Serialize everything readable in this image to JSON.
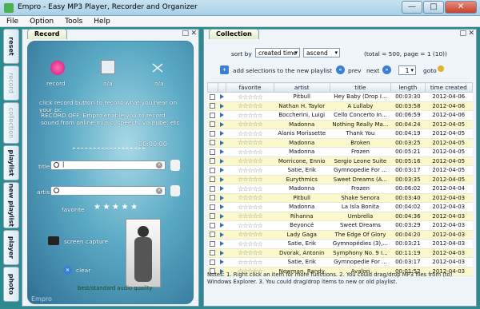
{
  "window": {
    "title": "Empro - Easy MP3 Player, Recorder and Organizer",
    "minimize": "—",
    "maximize": "□",
    "close": "✕"
  },
  "menu": [
    "File",
    "Option",
    "Tools",
    "Help"
  ],
  "sidetabs": [
    {
      "label": "reset",
      "dim": false
    },
    {
      "label": "record",
      "dim": true
    },
    {
      "label": "collection",
      "dim": true
    },
    {
      "label": "playlist",
      "dim": false
    },
    {
      "label": "new playlist",
      "dim": false
    },
    {
      "label": "player",
      "dim": false
    },
    {
      "label": "photo",
      "dim": false
    }
  ],
  "record": {
    "tab_label": "Record",
    "buttons": [
      {
        "label": "record",
        "icon": "record-dot-icon"
      },
      {
        "label": "n/a",
        "icon": "floppy-save-icon"
      },
      {
        "label": "n/a",
        "icon": "scissors-icon"
      }
    ],
    "hint": "click record button to record what you hear on your pc",
    "description": "RECORD.OFF: Empro enable you to record sound from online music, speech, youtube, etc.",
    "timer": "00:00:00",
    "title_label": "title",
    "title_value": "|",
    "artist_label": "artist",
    "artist_value": "",
    "favorite_label": "favorite",
    "favorite_stars": 5,
    "screen_capture_label": "screen capture",
    "clear_label": "clear",
    "quality_label": "best/standard audio quality",
    "ctrl_pin": "□",
    "ctrl_close": "✕"
  },
  "collection": {
    "tab_label": "Collection",
    "sort_label": "sort by",
    "sort_field": "created time",
    "sort_order": "ascend",
    "stats": "(total = 500, page = 1 (10))",
    "add_label": "add selections to the new playlist",
    "prev_label": "prev",
    "next_label": "next",
    "page_value": "1",
    "goto_label": "goto",
    "columns": [
      "favorite",
      "artist",
      "title",
      "length",
      "time created"
    ],
    "rows": [
      {
        "artist": "Pitbull",
        "title": "Hey Baby (Drop I...",
        "length": "00:03:30",
        "created": "2012-04-06"
      },
      {
        "artist": "Nathan H. Taylor",
        "title": "A Lullaby",
        "length": "00:03:58",
        "created": "2012-04-06"
      },
      {
        "artist": "Boccherini, Luigi",
        "title": "Cello Concerto In...",
        "length": "00:06:59",
        "created": "2012-04-06"
      },
      {
        "artist": "Madonna",
        "title": "Nothing Really Ma...",
        "length": "00:04:24",
        "created": "2012-04-05"
      },
      {
        "artist": "Alanis Morissette",
        "title": "Thank You",
        "length": "00:04:19",
        "created": "2012-04-05"
      },
      {
        "artist": "Madonna",
        "title": "Broken",
        "length": "00:03:25",
        "created": "2012-04-05"
      },
      {
        "artist": "Madonna",
        "title": "Frozen",
        "length": "00:05:21",
        "created": "2012-04-05"
      },
      {
        "artist": "Morricone, Ennio",
        "title": "Sergio Leone Suite",
        "length": "00:05:16",
        "created": "2012-04-05"
      },
      {
        "artist": "Satie, Erik",
        "title": "Gymnopedie For ...",
        "length": "00:03:17",
        "created": "2012-04-05"
      },
      {
        "artist": "Eurythmics",
        "title": "Sweet Dreams (A...",
        "length": "00:03:35",
        "created": "2012-04-05"
      },
      {
        "artist": "Madonna",
        "title": "Frozen",
        "length": "00:06:02",
        "created": "2012-04-04"
      },
      {
        "artist": "Pitbull",
        "title": "Shake Senora",
        "length": "00:03:40",
        "created": "2012-04-03"
      },
      {
        "artist": "Madonna",
        "title": "La Isla Bonita",
        "length": "00:04:02",
        "created": "2012-04-03"
      },
      {
        "artist": "Rihanna",
        "title": "Umbrella",
        "length": "00:04:36",
        "created": "2012-04-03"
      },
      {
        "artist": "Beyoncé",
        "title": "Sweet Dreams",
        "length": "00:03:29",
        "created": "2012-04-03"
      },
      {
        "artist": "Lady Gaga",
        "title": "The Edge Of Glory",
        "length": "00:04:20",
        "created": "2012-04-03"
      },
      {
        "artist": "Satie, Erik",
        "title": "Gymnopédies (3),...",
        "length": "00:03:21",
        "created": "2012-04-03"
      },
      {
        "artist": "Dvorak, Antonin",
        "title": "Symphony No. 9 I...",
        "length": "00:11:19",
        "created": "2012-04-03"
      },
      {
        "artist": "Satie, Erik",
        "title": "Gymnopedie For ...",
        "length": "00:03:17",
        "created": "2012-04-03"
      },
      {
        "artist": "Newman, Randy",
        "title": "Avalon",
        "length": "00:01:52",
        "created": "2012-04-03"
      }
    ],
    "notes": "Notes: 1. Right click an item for more functions. 2. You could drag/drop MP3 files from (to) Windows Explorer. 3. You could drag/drop items to new or old playlist.",
    "ctrl_pin": "□",
    "ctrl_close": "✕"
  },
  "watermark": "Empro"
}
